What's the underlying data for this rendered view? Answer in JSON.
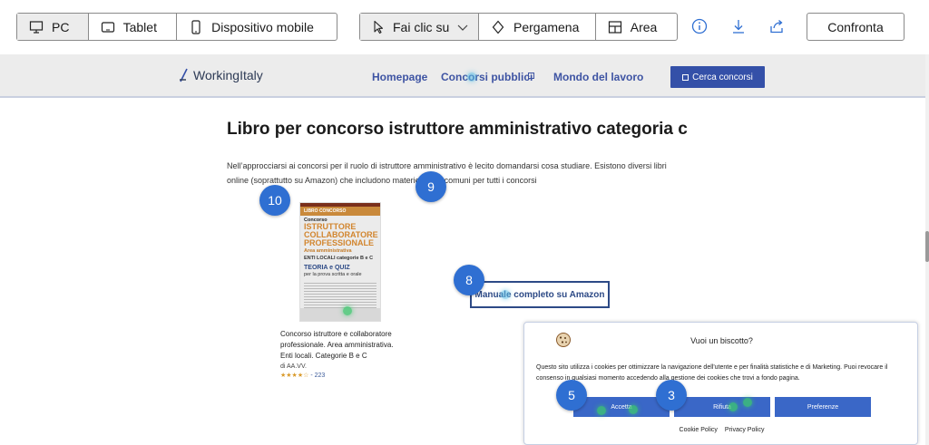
{
  "toolbar": {
    "devices": [
      {
        "label": "PC",
        "icon": "desktop-icon",
        "active": true
      },
      {
        "label": "Tablet",
        "icon": "tablet-icon",
        "active": false
      },
      {
        "label": "Dispositivo mobile",
        "icon": "mobile-icon",
        "active": false
      }
    ],
    "modes": [
      {
        "label": "Fai clic su",
        "icon": "cursor-icon",
        "active": true
      },
      {
        "label": "Pergamena",
        "icon": "scroll-icon",
        "active": false
      },
      {
        "label": "Area",
        "icon": "area-icon",
        "active": false
      }
    ],
    "icons": [
      "info-icon",
      "download-icon",
      "share-icon"
    ],
    "compare_label": "Confronta"
  },
  "site": {
    "logo_text": "WorkingItaly",
    "nav": [
      "Homepage",
      "Concorsi pubblici",
      "Mondo del lavoro"
    ],
    "cerca_label": "Cerca concorsi"
  },
  "article": {
    "title": "Libro per concorso istruttore amministrativo categoria c",
    "intro_line1": "Nell’approcciarsi ai concorsi per il ruolo di istruttore amministrativo è lecito domandarsi cosa studiare. Esistono diversi libri",
    "intro_line2": "online (soprattutto su Amazon) che includono materie molto comuni per tutti i concorsi"
  },
  "book": {
    "cover_header": "LIBRO CONCORSO",
    "cover_kicker": "Concorso",
    "cover_title1": "ISTRUTTORE",
    "cover_title2": "COLLABORATORE",
    "cover_title3": "PROFESSIONALE",
    "cover_sub": "Area amministrativa",
    "cover_enti": "ENTI LOCALI categorie B e C",
    "cover_teoria": "TEORIA e QUIZ",
    "cover_teoria_sub": "per la prova scritta e orale",
    "title": "Concorso istruttore e collaboratore professionale. Area amministrativa. Enti locali. Categorie B e C",
    "author": "di AA.VV.",
    "stars": "★★★★☆",
    "reviews": "223",
    "rating": 4
  },
  "amazon_button": "Manuale completo su Amazon",
  "cookie": {
    "title": "Vuoi un biscotto?",
    "text": "Questo sito utilizza i cookies per ottimizzare la navigazione dell'utente e per finalità statistiche e di Marketing. Puoi revocare il consenso in qualsiasi momento accedendo alla gestione dei cookies che trovi a fondo pagina.",
    "accept": "Accetta",
    "reject": "Rifiuta",
    "prefs": "Preferenze",
    "policy_links": [
      "Cookie Policy",
      "Privacy Policy"
    ]
  },
  "badges": [
    "10",
    "9",
    "8",
    "5",
    "3"
  ],
  "colors": {
    "badge": "#2f6fd2",
    "nav": "#3e54a3",
    "cta": "#3450a8",
    "cookie_btn": "#3a67c7"
  }
}
